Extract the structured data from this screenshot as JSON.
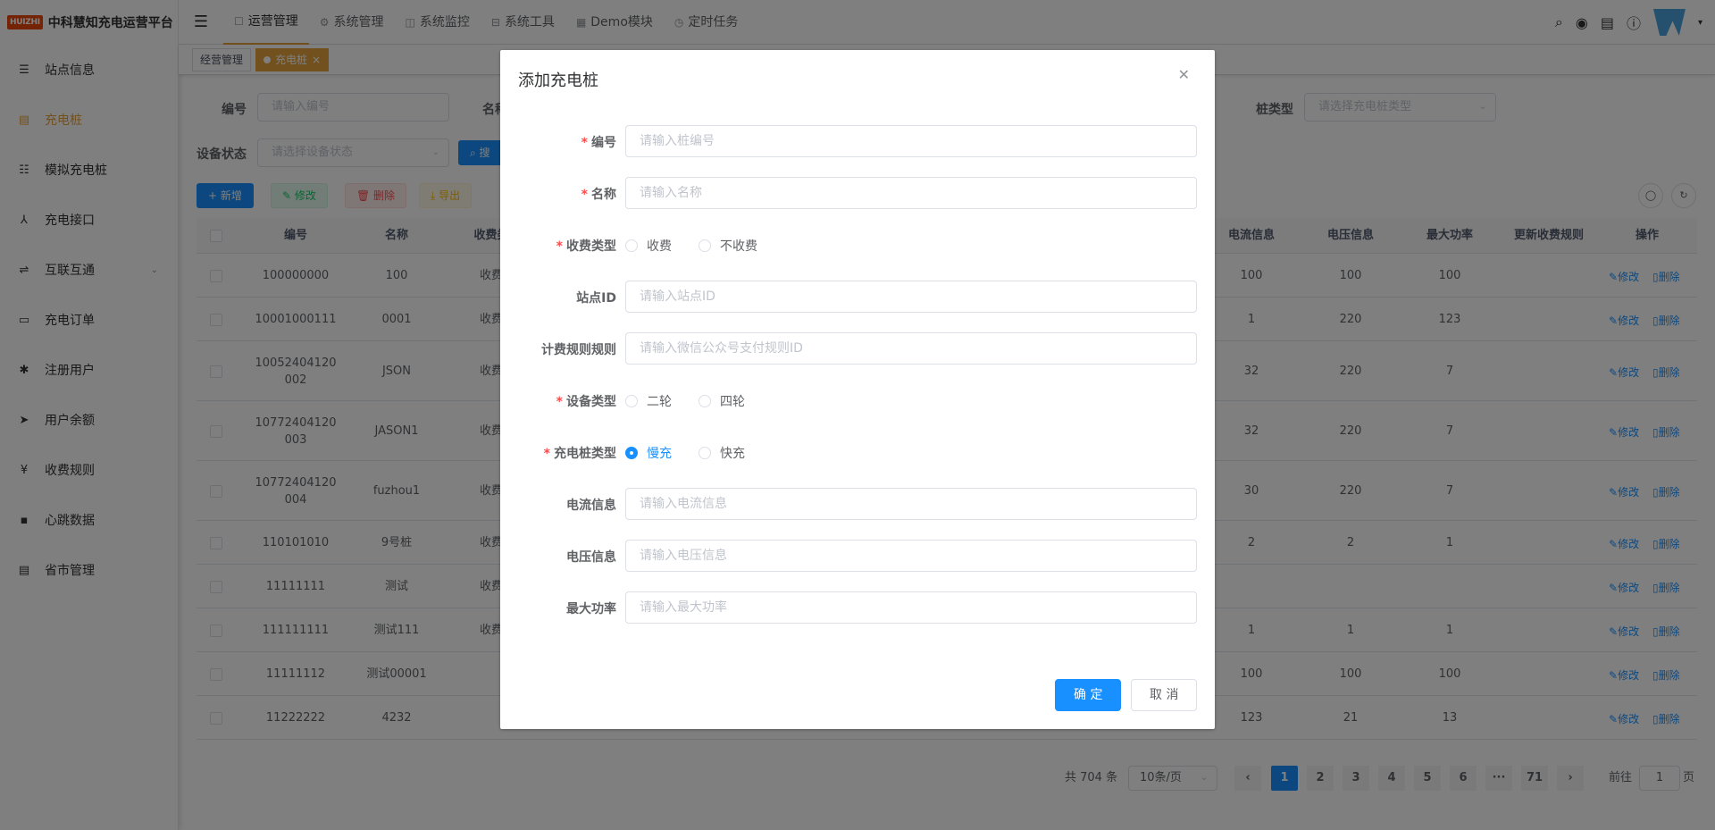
{
  "brand": {
    "badge": "HUIZHI",
    "title": "中科慧知充电运营平台"
  },
  "sidebar": {
    "items": [
      {
        "label": "站点信息",
        "icon": "list-icon",
        "glyph": "☰"
      },
      {
        "label": "充电桩",
        "icon": "charger-icon",
        "glyph": "▤"
      },
      {
        "label": "模拟充电桩",
        "icon": "tree-list-icon",
        "glyph": "☷"
      },
      {
        "label": "充电接口",
        "icon": "plug-icon",
        "glyph": "⅄"
      },
      {
        "label": "互联互通",
        "icon": "connect-icon",
        "glyph": "⇌"
      },
      {
        "label": "充电订单",
        "icon": "monitor-icon",
        "glyph": "▭"
      },
      {
        "label": "注册用户",
        "icon": "bug-icon",
        "glyph": "✱"
      },
      {
        "label": "用户余额",
        "icon": "send-icon",
        "glyph": "➤"
      },
      {
        "label": "收费规则",
        "icon": "yen-icon",
        "glyph": "¥"
      },
      {
        "label": "心跳数据",
        "icon": "server-icon",
        "glyph": "▪"
      },
      {
        "label": "省市管理",
        "icon": "document-icon",
        "glyph": "▤"
      }
    ]
  },
  "navbar": {
    "menus": [
      {
        "label": "运营管理",
        "icon": "☐"
      },
      {
        "label": "系统管理",
        "icon": "⚙"
      },
      {
        "label": "系统监控",
        "icon": "◫"
      },
      {
        "label": "系统工具",
        "icon": "⊟"
      },
      {
        "label": "Demo模块",
        "icon": "▦"
      },
      {
        "label": "定时任务",
        "icon": "◷"
      }
    ]
  },
  "tags": {
    "home": "经营管理",
    "current": "充电桩",
    "close": "×"
  },
  "filters": {
    "code_label": "编号",
    "code_placeholder": "请输入编号",
    "name_label": "名称",
    "pile_type_label": "桩类型",
    "pile_type_placeholder": "请选择充电桩类型",
    "status_label": "设备状态",
    "status_placeholder": "请选择设备状态",
    "search_label": "搜"
  },
  "toolbar": {
    "add": "+ 新增",
    "edit": "✎ 修改",
    "delete": "🗑 删除",
    "export": "⤓ 导出"
  },
  "table": {
    "headers": [
      "编号",
      "名称",
      "收费类",
      "电流信息",
      "电压信息",
      "最大功率",
      "更新收费规则",
      "操作"
    ],
    "edit": "修改",
    "del": "删除",
    "rows": [
      {
        "code": "100000000",
        "name": "100",
        "fee": "收费",
        "current": "100",
        "voltage": "100",
        "power": "100"
      },
      {
        "code": "10001000111",
        "name": "0001",
        "fee": "收费",
        "current": "1",
        "voltage": "220",
        "power": "123"
      },
      {
        "code": "10052404120\n002",
        "name": "JSON",
        "fee": "收费",
        "current": "32",
        "voltage": "220",
        "power": "7"
      },
      {
        "code": "10772404120\n003",
        "name": "JASON1",
        "fee": "收费",
        "current": "32",
        "voltage": "220",
        "power": "7"
      },
      {
        "code": "10772404120\n004",
        "name": "fuzhou1",
        "fee": "收费",
        "current": "30",
        "voltage": "220",
        "power": "7"
      },
      {
        "code": "110101010",
        "name": "9号桩",
        "fee": "收费",
        "current": "2",
        "voltage": "2",
        "power": "1"
      },
      {
        "code": "11111111",
        "name": "测试",
        "fee": "收费",
        "current": "",
        "voltage": "",
        "power": ""
      },
      {
        "code": "111111111",
        "name": "测试111",
        "fee": "收费",
        "current": "1",
        "voltage": "1",
        "power": "1"
      },
      {
        "code": "11111112",
        "name": "测试00001",
        "fee": "",
        "current": "100",
        "voltage": "100",
        "power": "100"
      },
      {
        "code": "11222222",
        "name": "4232",
        "fee": "",
        "current": "123",
        "voltage": "21",
        "power": "13"
      }
    ]
  },
  "pagination": {
    "total": "共 704 条",
    "page_size": "10条/页",
    "pages": [
      "1",
      "2",
      "3",
      "4",
      "5",
      "6",
      "···",
      "71"
    ],
    "goto": "前往",
    "goto_value": "1",
    "page_unit": "页"
  },
  "dialog": {
    "title": "添加充电桩",
    "fields": {
      "code": {
        "label": "编号",
        "placeholder": "请输入桩编号"
      },
      "name": {
        "label": "名称",
        "placeholder": "请输入名称"
      },
      "fee_type": {
        "label": "收费类型",
        "options": [
          "收费",
          "不收费"
        ]
      },
      "station": {
        "label": "站点ID",
        "placeholder": "请输入站点ID"
      },
      "billing": {
        "label": "计费规则规则",
        "placeholder": "请输入微信公众号支付规则ID"
      },
      "device_type": {
        "label": "设备类型",
        "options": [
          "二轮",
          "四轮"
        ]
      },
      "pile_type": {
        "label": "充电桩类型",
        "options": [
          "慢充",
          "快充"
        ],
        "selected": "慢充"
      },
      "current": {
        "label": "电流信息",
        "placeholder": "请输入电流信息"
      },
      "voltage": {
        "label": "电压信息",
        "placeholder": "请输入电压信息"
      },
      "power": {
        "label": "最大功率",
        "placeholder": "请输入最大功率"
      }
    },
    "confirm": "确 定",
    "cancel": "取 消"
  },
  "colors": {
    "primary": "#1890ff",
    "accent": "#e6a23c",
    "brand": "#e8470a"
  }
}
